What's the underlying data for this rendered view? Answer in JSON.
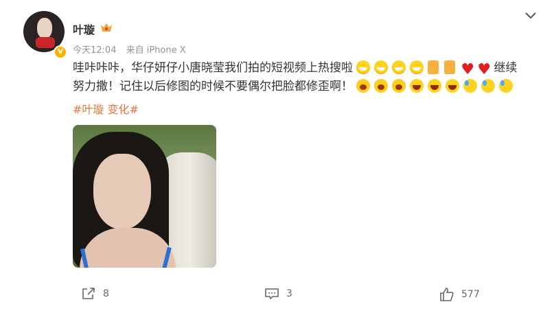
{
  "post": {
    "author": "叶璇",
    "time": "今天12:04",
    "source": "来自 iPhone X",
    "text_line1": "哇咔咔咔，华仔妍仔小唐晓莹我们拍的短视频上热搜啦",
    "text_continue": "继续",
    "text_line2": "努力撒！记住以后修图的时候不要偶尔把脸都修歪啊！",
    "topic": "#叶璇 变化#",
    "verified_badge": "V"
  },
  "actions": {
    "share_count": "8",
    "comment_count": "3",
    "like_count": "577"
  },
  "icons": {
    "badge": "crown-icon",
    "menu": "chevron-down-icon",
    "share": "share-icon",
    "comment": "comment-icon",
    "like": "thumbs-up-icon"
  },
  "colors": {
    "topic": "#eb7340",
    "meta": "#939393",
    "verified": "#f7b500"
  }
}
